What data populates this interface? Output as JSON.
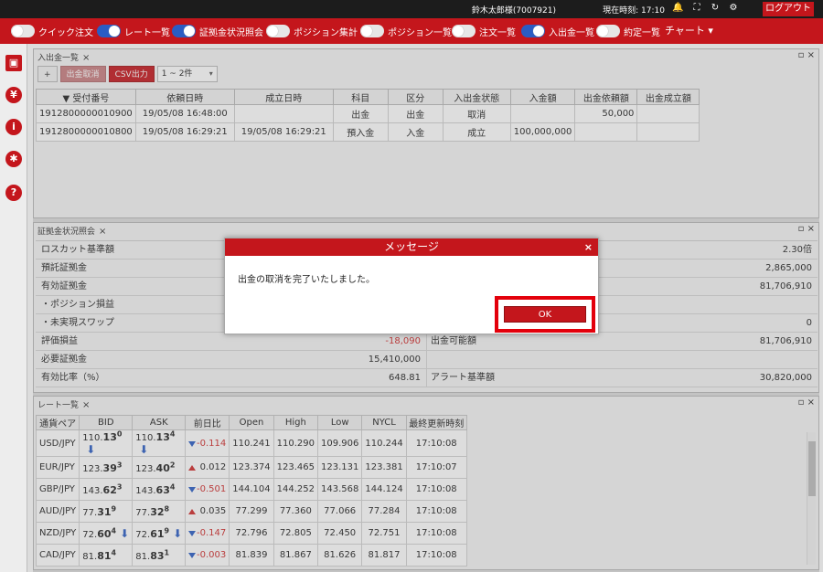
{
  "topbar": {
    "user": "鈴木太郎様(7007921)",
    "clock": "現在時刻: 17:10",
    "logout_label": "ログアウト"
  },
  "nav": {
    "items": [
      {
        "label": "クイック注文",
        "on": false
      },
      {
        "label": "レート一覧",
        "on": true
      },
      {
        "label": "証拠金状況照会",
        "on": true
      },
      {
        "label": "ポジション集計",
        "on": false
      },
      {
        "label": "ポジション一覧",
        "on": false
      },
      {
        "label": "注文一覧",
        "on": false
      },
      {
        "label": "入出金一覧",
        "on": true
      },
      {
        "label": "約定一覧",
        "on": false
      }
    ],
    "chart_label": "チャート ▾"
  },
  "deposit_panel": {
    "tab": "入出金一覧",
    "add_label": "+",
    "cancel_label": "出金取消",
    "csv_label": "CSV出力",
    "range": "1 ~ 2件",
    "headers": [
      "▼ 受付番号",
      "依頼日時",
      "成立日時",
      "科目",
      "区分",
      "入出金状態",
      "入金額",
      "出金依頼額",
      "出金成立額"
    ],
    "rows": [
      [
        "1912800000010900",
        "19/05/08 16:48:00",
        "",
        "出金",
        "出金",
        "取消",
        "",
        "50,000",
        ""
      ],
      [
        "1912800000010800",
        "19/05/08 16:29:21",
        "19/05/08 16:29:21",
        "預入金",
        "入金",
        "成立",
        "100,000,000",
        "",
        ""
      ]
    ]
  },
  "margin_panel": {
    "tab": "証拠金状況照会",
    "rows": [
      {
        "k1": "ロスカット基準額",
        "v1": "",
        "k2": "",
        "v2": "2.30倍"
      },
      {
        "k1": "預託証拠金",
        "v1": "",
        "k2": "",
        "v2": "2,865,000"
      },
      {
        "k1": "有効証拠金",
        "v1": "",
        "k2": "",
        "v2": "81,706,910"
      },
      {
        "k1": "・ポジション損益",
        "v1": "",
        "k2": "",
        "v2": ""
      },
      {
        "k1": "・未実現スワップ",
        "v1": "",
        "k2": "",
        "v2": "0"
      },
      {
        "k1": "評価損益",
        "v1": "-18,090",
        "k2": "出金可能額",
        "v2": "81,706,910"
      },
      {
        "k1": "必要証拠金",
        "v1": "15,410,000",
        "k2": "",
        "v2": ""
      },
      {
        "k1": "有効比率（%）",
        "v1": "648.81",
        "k2": "アラート基準額",
        "v2": "30,820,000"
      }
    ]
  },
  "rate_panel": {
    "tab": "レート一覧",
    "headers": [
      "通貨ペア",
      "BID",
      "ASK",
      "前日比",
      "Open",
      "High",
      "Low",
      "NYCL",
      "最終更新時刻"
    ],
    "rows": [
      {
        "pair": "USD/JPY",
        "bid_a": "110.",
        "bid_b": "13",
        "bid_c": "0",
        "bid_arrow": true,
        "ask_a": "110.",
        "ask_b": "13",
        "ask_c": "4",
        "ask_arrow": true,
        "dir": "down",
        "chg": "-0.114",
        "open": "110.241",
        "high": "110.290",
        "low": "109.906",
        "nycl": "110.244",
        "time": "17:10:08"
      },
      {
        "pair": "EUR/JPY",
        "bid_a": "123.",
        "bid_b": "39",
        "bid_c": "3",
        "bid_arrow": false,
        "ask_a": "123.",
        "ask_b": "40",
        "ask_c": "2",
        "ask_arrow": false,
        "dir": "up",
        "chg": "0.012",
        "open": "123.374",
        "high": "123.465",
        "low": "123.131",
        "nycl": "123.381",
        "time": "17:10:07"
      },
      {
        "pair": "GBP/JPY",
        "bid_a": "143.",
        "bid_b": "62",
        "bid_c": "3",
        "bid_arrow": false,
        "ask_a": "143.",
        "ask_b": "63",
        "ask_c": "4",
        "ask_arrow": false,
        "dir": "down",
        "chg": "-0.501",
        "open": "144.104",
        "high": "144.252",
        "low": "143.568",
        "nycl": "144.124",
        "time": "17:10:08"
      },
      {
        "pair": "AUD/JPY",
        "bid_a": "77.",
        "bid_b": "31",
        "bid_c": "9",
        "bid_arrow": false,
        "ask_a": "77.",
        "ask_b": "32",
        "ask_c": "8",
        "ask_arrow": false,
        "dir": "up",
        "chg": "0.035",
        "open": "77.299",
        "high": "77.360",
        "low": "77.066",
        "nycl": "77.284",
        "time": "17:10:08"
      },
      {
        "pair": "NZD/JPY",
        "bid_a": "72.",
        "bid_b": "60",
        "bid_c": "4",
        "bid_arrow": true,
        "ask_a": "72.",
        "ask_b": "61",
        "ask_c": "9",
        "ask_arrow": true,
        "dir": "down",
        "chg": "-0.147",
        "open": "72.796",
        "high": "72.805",
        "low": "72.450",
        "nycl": "72.751",
        "time": "17:10:08"
      },
      {
        "pair": "CAD/JPY",
        "bid_a": "81.",
        "bid_b": "81",
        "bid_c": "4",
        "bid_arrow": false,
        "ask_a": "81.",
        "ask_b": "83",
        "ask_c": "1",
        "ask_arrow": false,
        "dir": "down",
        "chg": "-0.003",
        "open": "81.839",
        "high": "81.867",
        "low": "81.626",
        "nycl": "81.817",
        "time": "17:10:08"
      }
    ]
  },
  "modal": {
    "title": "メッセージ",
    "close": "×",
    "message": "出金の取消を完了いたしました。",
    "ok_label": "OK"
  },
  "colors": {
    "brand_red": "#c4161c",
    "toggle_on": "#2a5cc4",
    "negative": "#d02b2b"
  }
}
